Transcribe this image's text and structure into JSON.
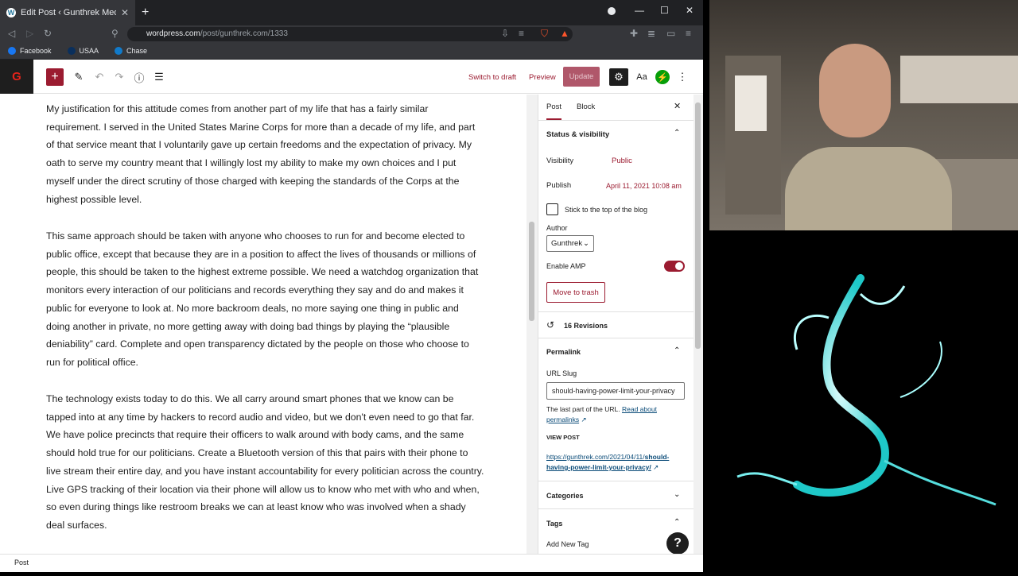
{
  "browser": {
    "tab_title": "Edit Post ‹ Gunthrek Media — W",
    "url_host": "wordpress.com",
    "url_path": "/post/gunthrek.com/1333",
    "bookmarks": [
      {
        "label": "Facebook",
        "color": "#1877f2"
      },
      {
        "label": "USAA",
        "color": "#0a2f5c"
      },
      {
        "label": "Chase",
        "color": "#117aca"
      }
    ]
  },
  "editor_header": {
    "site_letter": "G",
    "switch_to_draft": "Switch to draft",
    "preview": "Preview",
    "update": "Update",
    "typography": "Aa"
  },
  "content": {
    "paragraphs": [
      "My justification for this attitude comes from another part of my life that has a fairly similar requirement.  I served in the United States Marine Corps for more than a decade of my life, and part of that service meant that I voluntarily gave up certain freedoms and the expectation of privacy.  My oath to serve my country meant that I willingly lost my ability to make my own choices and I put myself under the direct scrutiny of those charged with keeping the standards of the Corps at the highest possible level.",
      "This same approach should be taken with anyone who chooses to run for and become elected to public office, except that because they are in a position to affect the lives of thousands or millions of people, this should be taken to the highest extreme possible.  We need a watchdog organization that monitors every interaction of our politicians and records everything they say and do and makes it public for everyone to look at.  No more backroom deals, no more saying one thing in public and doing another in private, no more getting away with doing bad things by playing the “plausible deniability” card.  Complete and open transparency dictated by the people on those who choose to run for political office.",
      "The technology exists today to do this.  We all carry around smart phones that we know can be tapped into at any time by hackers to record audio and video, but we don't even need to go that far. We have police precincts that require their officers to walk around with body cams, and the same should hold true for our politicians.  Create a Bluetooth version of this that pairs with their phone to live stream their entire day, and you have instant accountability for every politician across the country.  Live GPS tracking of their location via their phone will allow us to know who met with who and when, so even during things like restroom breaks we can at least know who was involved when a shady deal surfaces."
    ]
  },
  "sidebar": {
    "tab_post": "Post",
    "tab_block": "Block",
    "status_title": "Status & visibility",
    "visibility_label": "Visibility",
    "visibility_value": "Public",
    "publish_label": "Publish",
    "publish_value": "April 11, 2021 10:08 am",
    "sticky_label": "Stick to the top of the blog",
    "author_label": "Author",
    "author_value": "Gunthrek",
    "amp_label": "Enable AMP",
    "trash_label": "Move to trash",
    "revisions": "16 Revisions",
    "permalink_title": "Permalink",
    "slug_label": "URL Slug",
    "slug_value": "should-having-power-limit-your-privacy",
    "slug_help": "The last part of the URL.",
    "slug_help_link": "Read about permalinks",
    "view_post_label": "VIEW POST",
    "view_post_url_a": "https://gunthrek.com/2021/04/11/",
    "view_post_url_b": "should-having-power-limit-your-privacy/",
    "categories_title": "Categories",
    "tags_title": "Tags",
    "add_tag_label": "Add New Tag"
  },
  "footer": {
    "breadcrumb": "Post"
  }
}
